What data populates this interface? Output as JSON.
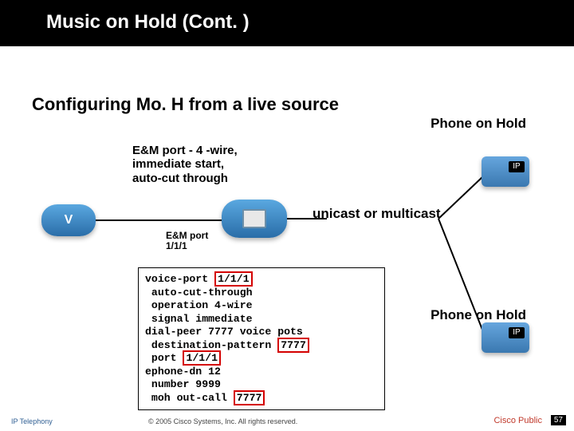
{
  "slide": {
    "title": "Music on Hold (Cont. )",
    "subtitle": "Configuring Mo. H from a live source"
  },
  "labels": {
    "phone_on_hold_top": "Phone on Hold",
    "phone_on_hold_bottom": "Phone on Hold",
    "em_port_caption_l1": "E&M port - 4 -wire,",
    "em_port_caption_l2": "immediate start,",
    "em_port_caption_l3": "auto-cut through",
    "unicast": "unicast or multicast",
    "em_port_label_l1": "E&M port",
    "em_port_label_l2": "1/1/1"
  },
  "config": {
    "l1_a": "voice-port ",
    "l1_b": "1/1/1",
    "l2": " auto-cut-through",
    "l3": " operation 4-wire",
    "l4": " signal immediate",
    "l5": "dial-peer 7777 voice pots",
    "l6_a": " destination-pattern ",
    "l6_b": "7777",
    "l7_a": " port ",
    "l7_b": "1/1/1",
    "l8": "ephone-dn 12",
    "l9": " number 9999",
    "l10_a": " moh out-call ",
    "l10_b": "7777"
  },
  "footer": {
    "left": "IP Telephony",
    "mid": "© 2005 Cisco Systems, Inc. All rights reserved.",
    "right": "Cisco Public",
    "page": "57"
  }
}
